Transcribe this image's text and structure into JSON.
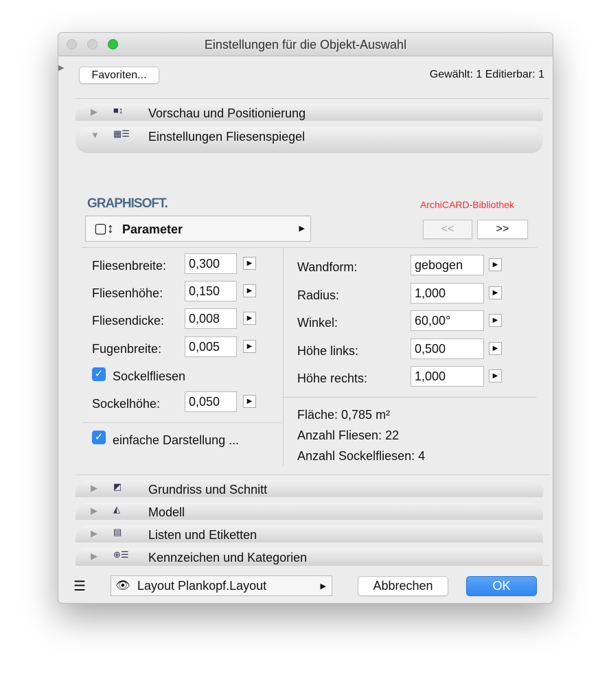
{
  "window": {
    "title": "Einstellungen für die Objekt-Auswahl"
  },
  "toolbar": {
    "favorites": "Favoriten...",
    "selection_info": "Gewählt: 1 Editierbar: 1"
  },
  "sections": [
    {
      "label": "Vorschau und Positionierung",
      "expanded": false
    },
    {
      "label": "Einstellungen Fliesenspiegel",
      "expanded": true
    },
    {
      "label": "Grundriss und Schnitt",
      "expanded": false
    },
    {
      "label": "Modell",
      "expanded": false
    },
    {
      "label": "Listen und Etiketten",
      "expanded": false
    },
    {
      "label": "Kennzeichen und Kategorien",
      "expanded": false
    }
  ],
  "panel": {
    "brand": "GRAPHISOFT.",
    "library": "ArchiCARD-Bibliothek",
    "page_select": "Parameter",
    "prev": "<<",
    "next": ">>",
    "left_fields": [
      {
        "label": "Fliesenbreite:",
        "value": "0,300"
      },
      {
        "label": "Fliesenhöhe:",
        "value": "0,150"
      },
      {
        "label": "Fliesendicke:",
        "value": "0,008"
      },
      {
        "label": "Fugenbreite:",
        "value": "0,005"
      }
    ],
    "sockel_check": {
      "label": "Sockelfliesen",
      "checked": true
    },
    "sockel_height": {
      "label": "Sockelhöhe:",
      "value": "0,050"
    },
    "simple_check": {
      "label": "einfache Darstellung ...",
      "checked": true
    },
    "right_fields": [
      {
        "label": "Wandform:",
        "value": "gebogen"
      },
      {
        "label": "Radius:",
        "value": "1,000"
      },
      {
        "label": "Winkel:",
        "value": "60,00°"
      },
      {
        "label": "Höhe links:",
        "value": "0,500"
      },
      {
        "label": "Höhe rechts:",
        "value": "1,000"
      }
    ],
    "info": [
      "Fläche: 0,785 m²",
      "Anzahl Fliesen: 22",
      "Anzahl Sockelfliesen: 4"
    ]
  },
  "footer": {
    "layout": "Layout Plankopf.Layout",
    "cancel": "Abbrechen",
    "ok": "OK"
  },
  "colors": {
    "accent": "#2f87f0",
    "library": "#ff2a2a",
    "brand": "#4a6a8a"
  }
}
